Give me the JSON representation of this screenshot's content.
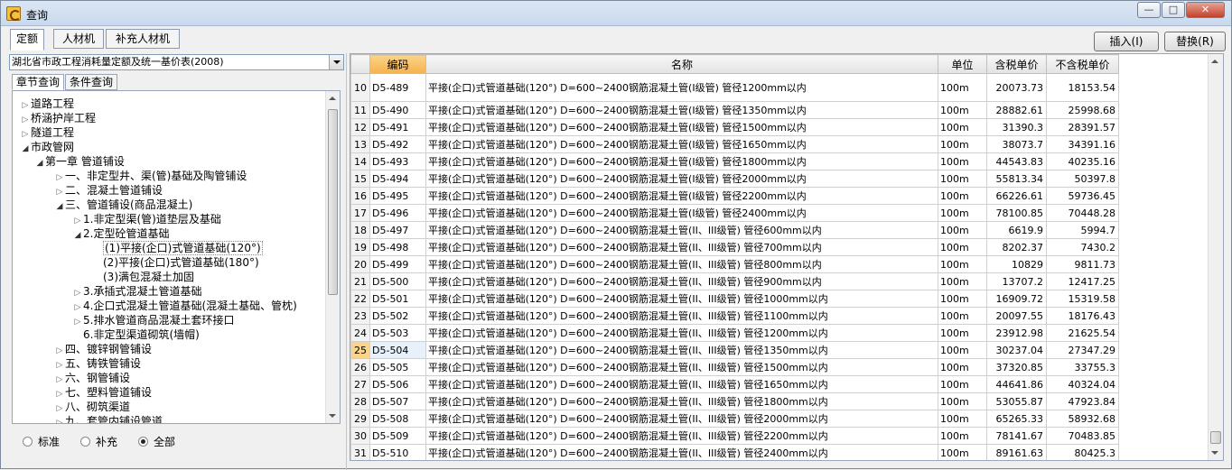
{
  "window": {
    "title": "查询"
  },
  "title_buttons": {
    "minimize": "—",
    "maximize": "□",
    "close": "✕"
  },
  "top_tabs": [
    "定额",
    "人材机",
    "补充人材机"
  ],
  "actions": {
    "insert": "插入(I)",
    "replace": "替换(R)"
  },
  "library": {
    "selected": "湖北省市政工程消耗量定额及统一基价表(2008)"
  },
  "side_tabs": [
    "章节查询",
    "条件查询"
  ],
  "tree": [
    {
      "label": "道路工程",
      "arrow": "▷"
    },
    {
      "label": "桥涵护岸工程",
      "arrow": "▷"
    },
    {
      "label": "隧道工程",
      "arrow": "▷"
    },
    {
      "label": "市政管网",
      "arrow": "◢"
    },
    {
      "label": "第一章 管道铺设",
      "arrow": "◢"
    },
    {
      "label": "一、非定型井、渠(管)基础及陶管铺设",
      "arrow": "▷"
    },
    {
      "label": "二、混凝土管道铺设",
      "arrow": "▷"
    },
    {
      "label": "三、管道铺设(商品混凝土)",
      "arrow": "◢"
    },
    {
      "label": "1.非定型渠(管)道垫层及基础",
      "arrow": "▷"
    },
    {
      "label": "2.定型砼管道基础",
      "arrow": "◢"
    },
    {
      "label": "(1)平接(企口)式管道基础(120°)",
      "arrow": ""
    },
    {
      "label": "(2)平接(企口)式管道基础(180°)",
      "arrow": ""
    },
    {
      "label": "(3)满包混凝土加固",
      "arrow": ""
    },
    {
      "label": "3.承插式混凝土管道基础",
      "arrow": "▷"
    },
    {
      "label": "4.企口式混凝土管道基础(混凝土基础、管枕)",
      "arrow": "▷"
    },
    {
      "label": "5.排水管道商品混凝土套环接口",
      "arrow": "▷"
    },
    {
      "label": "6.非定型渠道砌筑(墙帽)",
      "arrow": ""
    },
    {
      "label": "四、镀锌钢管铺设",
      "arrow": "▷"
    },
    {
      "label": "五、铸铁管铺设",
      "arrow": "▷"
    },
    {
      "label": "六、钢管铺设",
      "arrow": "▷"
    },
    {
      "label": "七、塑料管道铺设",
      "arrow": "▷"
    },
    {
      "label": "八、砌筑渠道",
      "arrow": "▷"
    },
    {
      "label": "九、套管内铺设管道",
      "arrow": "▷"
    }
  ],
  "radios": [
    "标准",
    "补充",
    "全部"
  ],
  "table": {
    "headers": [
      "编码",
      "名称",
      "单位",
      "含税单价",
      "不含税单价"
    ],
    "rows": [
      {
        "n": "10",
        "code": "D5-489",
        "name": "平接(企口)式管道基础(120°) D=600~2400钢筋混凝土管(I级管) 管径1200mm以内",
        "unit": "100m",
        "tax": "20073.73",
        "notax": "18153.54"
      },
      {
        "n": "11",
        "code": "D5-490",
        "name": "平接(企口)式管道基础(120°) D=600~2400钢筋混凝土管(I级管) 管径1350mm以内",
        "unit": "100m",
        "tax": "28882.61",
        "notax": "25998.68"
      },
      {
        "n": "12",
        "code": "D5-491",
        "name": "平接(企口)式管道基础(120°) D=600~2400钢筋混凝土管(I级管) 管径1500mm以内",
        "unit": "100m",
        "tax": "31390.3",
        "notax": "28391.57"
      },
      {
        "n": "13",
        "code": "D5-492",
        "name": "平接(企口)式管道基础(120°) D=600~2400钢筋混凝土管(I级管) 管径1650mm以内",
        "unit": "100m",
        "tax": "38073.7",
        "notax": "34391.16"
      },
      {
        "n": "14",
        "code": "D5-493",
        "name": "平接(企口)式管道基础(120°) D=600~2400钢筋混凝土管(I级管) 管径1800mm以内",
        "unit": "100m",
        "tax": "44543.83",
        "notax": "40235.16"
      },
      {
        "n": "15",
        "code": "D5-494",
        "name": "平接(企口)式管道基础(120°) D=600~2400钢筋混凝土管(I级管) 管径2000mm以内",
        "unit": "100m",
        "tax": "55813.34",
        "notax": "50397.8"
      },
      {
        "n": "16",
        "code": "D5-495",
        "name": "平接(企口)式管道基础(120°) D=600~2400钢筋混凝土管(I级管) 管径2200mm以内",
        "unit": "100m",
        "tax": "66226.61",
        "notax": "59736.45"
      },
      {
        "n": "17",
        "code": "D5-496",
        "name": "平接(企口)式管道基础(120°) D=600~2400钢筋混凝土管(I级管) 管径2400mm以内",
        "unit": "100m",
        "tax": "78100.85",
        "notax": "70448.28"
      },
      {
        "n": "18",
        "code": "D5-497",
        "name": "平接(企口)式管道基础(120°) D=600~2400钢筋混凝土管(II、III级管) 管径600mm以内",
        "unit": "100m",
        "tax": "6619.9",
        "notax": "5994.7"
      },
      {
        "n": "19",
        "code": "D5-498",
        "name": "平接(企口)式管道基础(120°) D=600~2400钢筋混凝土管(II、III级管) 管径700mm以内",
        "unit": "100m",
        "tax": "8202.37",
        "notax": "7430.2"
      },
      {
        "n": "20",
        "code": "D5-499",
        "name": "平接(企口)式管道基础(120°) D=600~2400钢筋混凝土管(II、III级管) 管径800mm以内",
        "unit": "100m",
        "tax": "10829",
        "notax": "9811.73"
      },
      {
        "n": "21",
        "code": "D5-500",
        "name": "平接(企口)式管道基础(120°) D=600~2400钢筋混凝土管(II、III级管) 管径900mm以内",
        "unit": "100m",
        "tax": "13707.2",
        "notax": "12417.25"
      },
      {
        "n": "22",
        "code": "D5-501",
        "name": "平接(企口)式管道基础(120°) D=600~2400钢筋混凝土管(II、III级管) 管径1000mm以内",
        "unit": "100m",
        "tax": "16909.72",
        "notax": "15319.58"
      },
      {
        "n": "23",
        "code": "D5-502",
        "name": "平接(企口)式管道基础(120°) D=600~2400钢筋混凝土管(II、III级管) 管径1100mm以内",
        "unit": "100m",
        "tax": "20097.55",
        "notax": "18176.43"
      },
      {
        "n": "24",
        "code": "D5-503",
        "name": "平接(企口)式管道基础(120°) D=600~2400钢筋混凝土管(II、III级管) 管径1200mm以内",
        "unit": "100m",
        "tax": "23912.98",
        "notax": "21625.54"
      },
      {
        "n": "25",
        "code": "D5-504",
        "name": "平接(企口)式管道基础(120°) D=600~2400钢筋混凝土管(II、III级管) 管径1350mm以内",
        "unit": "100m",
        "tax": "30237.04",
        "notax": "27347.29",
        "current": true
      },
      {
        "n": "26",
        "code": "D5-505",
        "name": "平接(企口)式管道基础(120°) D=600~2400钢筋混凝土管(II、III级管) 管径1500mm以内",
        "unit": "100m",
        "tax": "37320.85",
        "notax": "33755.3"
      },
      {
        "n": "27",
        "code": "D5-506",
        "name": "平接(企口)式管道基础(120°) D=600~2400钢筋混凝土管(II、III级管) 管径1650mm以内",
        "unit": "100m",
        "tax": "44641.86",
        "notax": "40324.04"
      },
      {
        "n": "28",
        "code": "D5-507",
        "name": "平接(企口)式管道基础(120°) D=600~2400钢筋混凝土管(II、III级管) 管径1800mm以内",
        "unit": "100m",
        "tax": "53055.87",
        "notax": "47923.84"
      },
      {
        "n": "29",
        "code": "D5-508",
        "name": "平接(企口)式管道基础(120°) D=600~2400钢筋混凝土管(II、III级管) 管径2000mm以内",
        "unit": "100m",
        "tax": "65265.33",
        "notax": "58932.68"
      },
      {
        "n": "30",
        "code": "D5-509",
        "name": "平接(企口)式管道基础(120°) D=600~2400钢筋混凝土管(II、III级管) 管径2200mm以内",
        "unit": "100m",
        "tax": "78141.67",
        "notax": "70483.85"
      },
      {
        "n": "31",
        "code": "D5-510",
        "name": "平接(企口)式管道基础(120°) D=600~2400钢筋混凝土管(II、III级管) 管径2400mm以内",
        "unit": "100m",
        "tax": "89161.63",
        "notax": "80425.3"
      }
    ]
  }
}
